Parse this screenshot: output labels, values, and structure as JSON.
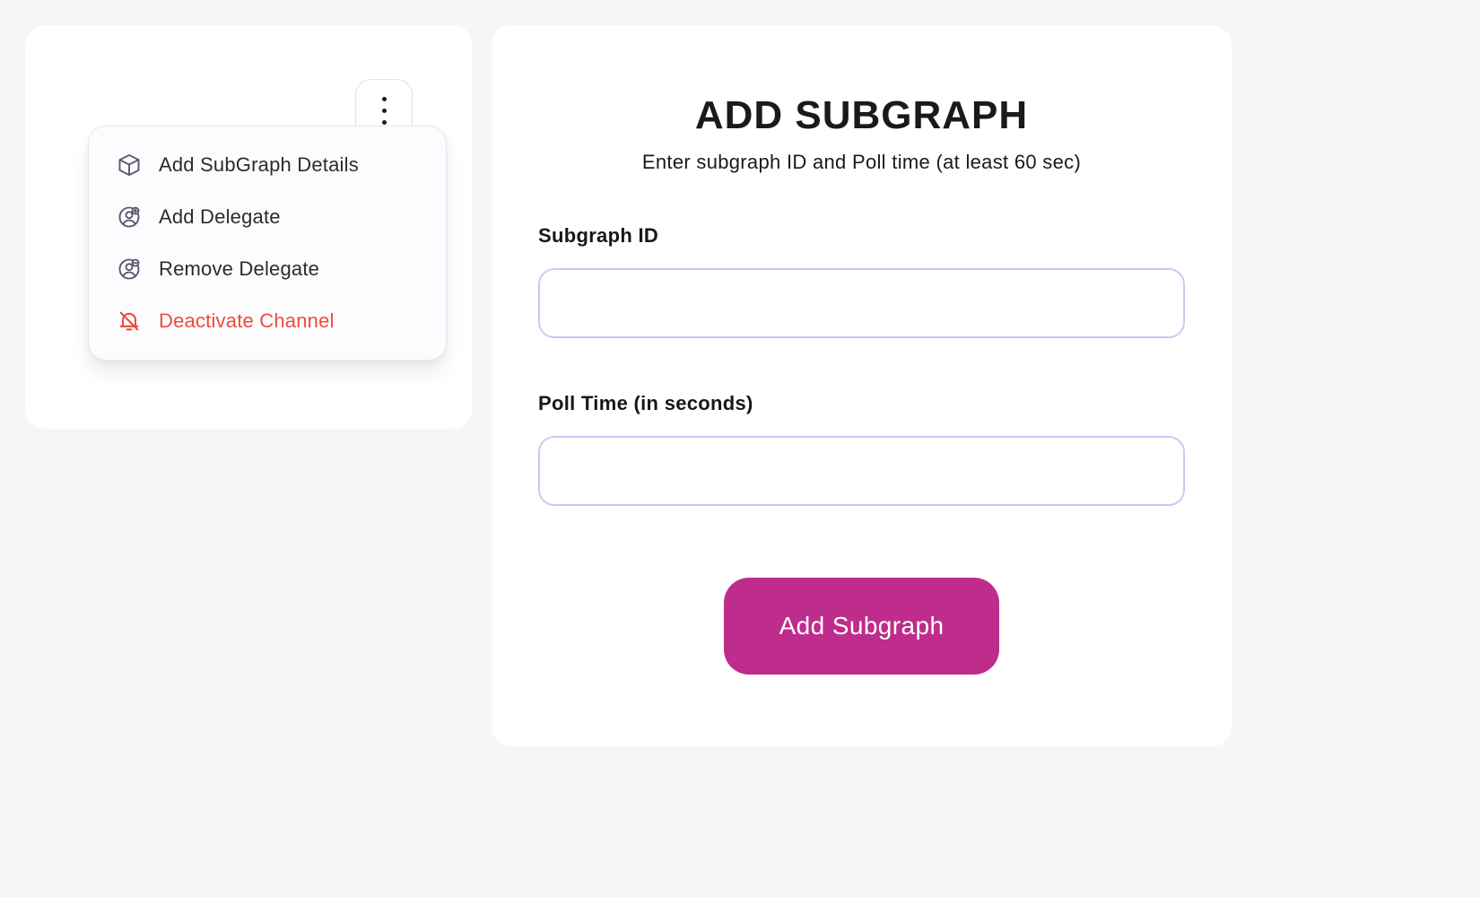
{
  "menu": {
    "items": [
      {
        "label": "Add SubGraph Details",
        "icon": "cube-icon"
      },
      {
        "label": "Add Delegate",
        "icon": "user-plus-icon"
      },
      {
        "label": "Remove Delegate",
        "icon": "user-minus-icon"
      },
      {
        "label": "Deactivate Channel",
        "icon": "bell-off-icon"
      }
    ]
  },
  "form": {
    "title": "ADD SUBGRAPH",
    "subtitle": "Enter subgraph ID and Poll time (at least 60 sec)",
    "subgraph_label": "Subgraph ID",
    "subgraph_value": "",
    "polltime_label": "Poll Time (in seconds)",
    "polltime_value": "",
    "submit_label": "Add Subgraph"
  },
  "colors": {
    "accent": "#be2d8b",
    "danger": "#ee4b3a"
  }
}
